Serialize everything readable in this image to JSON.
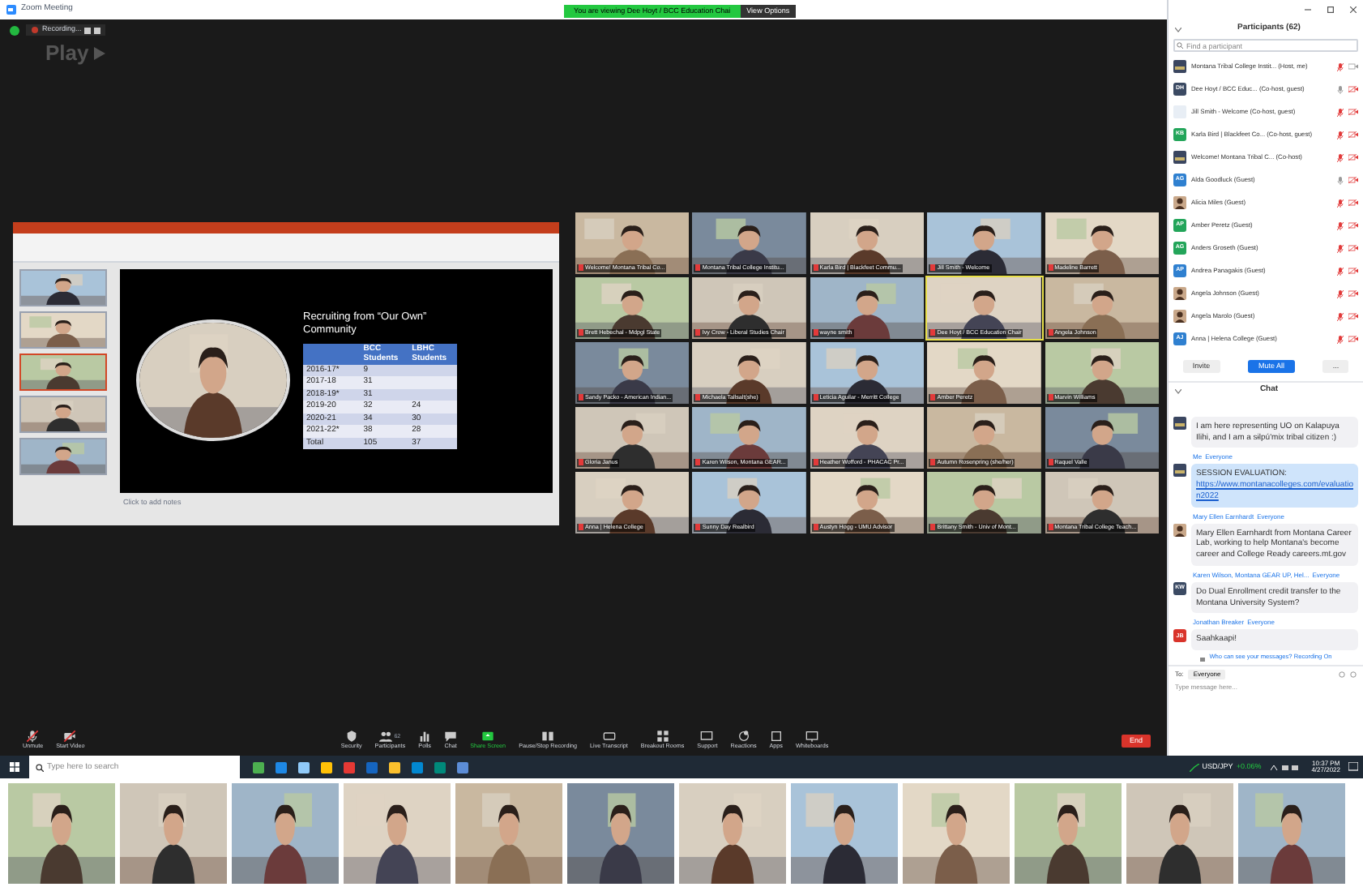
{
  "window": {
    "title": "Zoom Meeting"
  },
  "banner": {
    "text": "You are viewing Dee Hoyt / BCC Education Chai",
    "button": "View Options"
  },
  "recording": {
    "label": "Recording...",
    "overlay": "Play"
  },
  "presentation": {
    "slide_title": "Recruiting from “Our Own” Community",
    "columns": [
      "",
      "BCC Students",
      "LBHC Students"
    ],
    "rows": [
      [
        "2016-17*",
        "9",
        ""
      ],
      [
        "2017-18",
        "31",
        ""
      ],
      [
        "2018-19*",
        "31",
        ""
      ],
      [
        "2019-20",
        "32",
        "24"
      ],
      [
        "2020-21",
        "34",
        "30"
      ],
      [
        "2021-22*",
        "38",
        "28"
      ],
      [
        "Total",
        "105",
        "37"
      ]
    ],
    "thumbnails": [
      {
        "selected": false
      },
      {
        "selected": false
      },
      {
        "selected": true
      },
      {
        "selected": false
      },
      {
        "selected": false
      }
    ],
    "notes_placeholder": "Click to add notes"
  },
  "gallery": [
    {
      "name": "Welcome! Montana Tribal Co...",
      "active_speaker": false
    },
    {
      "name": "Montana Tribal College Institu...",
      "active_speaker": false
    },
    {
      "name": "Karla Bird | Blackfeet Commu...",
      "active_speaker": false
    },
    {
      "name": "Jill Smith - Welcome",
      "active_speaker": false
    },
    {
      "name": "Madeline Barrett",
      "active_speaker": false
    },
    {
      "name": "Brett Hebechal - Mdpgl State",
      "active_speaker": false
    },
    {
      "name": "Ivy Crow - Liberal Studies Chair",
      "active_speaker": false
    },
    {
      "name": "wayne smith",
      "active_speaker": false
    },
    {
      "name": "Dee Hoyt / BCC Education Chair",
      "active_speaker": true
    },
    {
      "name": "Angela Johnson",
      "active_speaker": false
    },
    {
      "name": "Sandy Packo - American Indian...",
      "active_speaker": false
    },
    {
      "name": "Michaela Tallsalt(she)",
      "active_speaker": false
    },
    {
      "name": "Leticia Aguilar - Merritt College",
      "active_speaker": false
    },
    {
      "name": "Amber Peretz",
      "active_speaker": false
    },
    {
      "name": "Marvin Williams",
      "active_speaker": false
    },
    {
      "name": "Gloria Janus",
      "active_speaker": false
    },
    {
      "name": "Karen Wilson, Montana GEAR...",
      "active_speaker": false
    },
    {
      "name": "Heather Wofford - PHACAC Pr...",
      "active_speaker": false
    },
    {
      "name": "Autumn Rosenpring (she/her)",
      "active_speaker": false
    },
    {
      "name": "Raquel Valle",
      "active_speaker": false
    },
    {
      "name": "Anna | Helena College",
      "active_speaker": false
    },
    {
      "name": "Sunny Day Realbird",
      "active_speaker": false
    },
    {
      "name": "Austyn Hogg - UMU Advisor",
      "active_speaker": false
    },
    {
      "name": "Brittany Smith - Univ of Mont...",
      "active_speaker": false
    },
    {
      "name": "Montana Tribal College Teach...",
      "active_speaker": false
    }
  ],
  "participants": {
    "title": "Participants (62)",
    "search_placeholder": "Find a participant",
    "items": [
      {
        "name": "Montana Tribal College Instit...",
        "role": "(Host, me)",
        "kind": "logo",
        "muted": true,
        "video_off": false
      },
      {
        "name": "Dee Hoyt / BCC Educ...",
        "role": "(Co-host, guest)",
        "kind": "initials",
        "initials": "DH",
        "color": "#3b4a63",
        "muted": false,
        "video_off": true
      },
      {
        "name": "Jill Smith - Welcome",
        "role": "(Co-host, guest)",
        "kind": "blank",
        "muted": true,
        "video_off": true
      },
      {
        "name": "Karla Bird | Blackfeet Co...",
        "role": "(Co-host, guest)",
        "kind": "initials",
        "initials": "KB",
        "color": "#23a55a",
        "muted": true,
        "video_off": true
      },
      {
        "name": "Welcome! Montana Tribal C...",
        "role": "(Co-host)",
        "kind": "logo",
        "muted": true,
        "video_off": true
      },
      {
        "name": "Alda Goodluck",
        "role": "(Guest)",
        "kind": "initials",
        "initials": "AG",
        "color": "#2f80d0",
        "muted": false,
        "video_off": true
      },
      {
        "name": "Alicia Miles",
        "role": "(Guest)",
        "muted": true,
        "video_off": true
      },
      {
        "name": "Amber Peretz",
        "role": "(Guest)",
        "kind": "initials",
        "initials": "AP",
        "color": "#23a55a",
        "muted": true,
        "video_off": true
      },
      {
        "name": "Anders Groseth",
        "role": "(Guest)",
        "kind": "initials",
        "initials": "AG",
        "color": "#23a55a",
        "muted": true,
        "video_off": true
      },
      {
        "name": "Andrea Panagakis",
        "role": "(Guest)",
        "kind": "initials",
        "initials": "AP",
        "color": "#2f80d0",
        "muted": true,
        "video_off": true
      },
      {
        "name": "Angela Johnson",
        "role": "(Guest)",
        "muted": true,
        "video_off": true
      },
      {
        "name": "Angela Marolo",
        "role": "(Guest)",
        "muted": true,
        "video_off": true
      },
      {
        "name": "Anna | Helena College",
        "role": "(Guest)",
        "kind": "initials",
        "initials": "AJ",
        "color": "#2f80d0",
        "muted": true,
        "video_off": true
      }
    ],
    "buttons": [
      {
        "label": "Invite",
        "primary": false
      },
      {
        "label": "Mute All",
        "primary": true
      },
      {
        "label": "...",
        "primary": false
      }
    ]
  },
  "chat": {
    "title": "Chat",
    "messages": [
      {
        "text": "I am here representing UO on Kalapuya Ilihi, and I am a sɨlpú'mix tribal citizen :)",
        "kind": "logo"
      },
      {
        "sender": "Me",
        "to": "Everyone",
        "text": "SESSION EVALUATION:",
        "link": "https://www.montanacolleges.com/evaluation2022",
        "kind": "logo"
      },
      {
        "sender": "Mary Ellen Earnhardt",
        "to": "Everyone",
        "text": "Mary Ellen Earnhardt from Montana Career Lab, working to help Montana's become career and College Ready   careers.mt.gov"
      },
      {
        "sender": "Karen Wilson, Montana GEAR UP, Hel...",
        "to": "Everyone",
        "text": "Do Dual Enrollment credit transfer to the Montana University System?",
        "kind": "initials",
        "initials": "KW",
        "color": "#3b4a63"
      },
      {
        "sender": "Jonathan Breaker",
        "to": "Everyone",
        "text": "Saahkaapi!",
        "kind": "initials",
        "initials": "JB",
        "color": "#d9342b"
      }
    ],
    "privacy": "Who can see your messages? Recording On",
    "to_label": "To:",
    "recipient": "Everyone",
    "placeholder": "Type message here..."
  },
  "toolbar": [
    {
      "label": "Unmute",
      "kind": "mic"
    },
    {
      "label": "Start Video",
      "kind": "video"
    },
    {
      "label": "Security",
      "kind": "shield"
    },
    {
      "label": "Participants",
      "kind": "people",
      "badge": "62"
    },
    {
      "label": "Polls",
      "kind": "chart"
    },
    {
      "label": "Chat",
      "kind": "chat"
    },
    {
      "label": "Share Screen",
      "kind": "share"
    },
    {
      "label": "Pause/Stop Recording",
      "kind": "record"
    },
    {
      "label": "Live Transcript",
      "kind": "cc"
    },
    {
      "label": "Breakout Rooms",
      "kind": "grid"
    },
    {
      "label": "Support",
      "kind": "support"
    },
    {
      "label": "Reactions",
      "kind": "reaction"
    },
    {
      "label": "Apps",
      "kind": "apps"
    },
    {
      "label": "Whiteboards",
      "kind": "whiteboard"
    }
  ],
  "end_button": "End",
  "taskbar": {
    "search_placeholder": "Type here to search",
    "ticker": "USD/JPY",
    "change": "+0.06%",
    "time": "10:37 PM",
    "date": "4/27/2022"
  }
}
